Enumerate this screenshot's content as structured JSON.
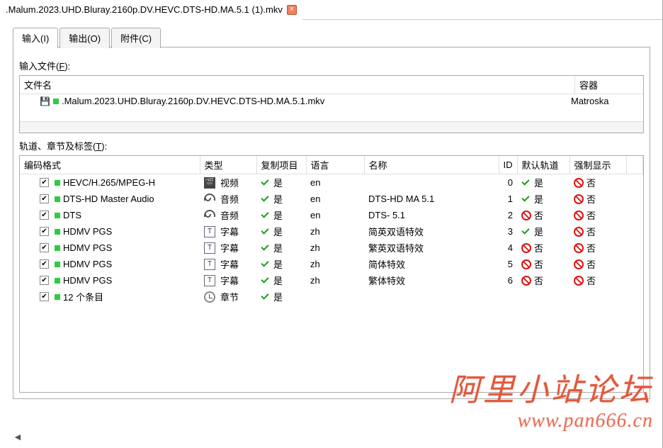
{
  "topTab": {
    "filename": ".Malum.2023.UHD.Bluray.2160p.DV.HEVC.DTS-HD.MA.5.1 (1).mkv"
  },
  "pageTabs": {
    "input": "输入(I)",
    "output": "输出(O)",
    "attach": "附件(C)"
  },
  "labels": {
    "inputFiles": "输入文件(F):",
    "tracksChapters": "轨道、章节及标签(T):"
  },
  "filesHeader": {
    "name": "文件名",
    "container": "容器"
  },
  "fileRow": {
    "name": ".Malum.2023.UHD.Bluray.2160p.DV.HEVC.DTS-HD.MA.5.1.mkv",
    "container": "Matroska"
  },
  "tracksHeader": {
    "codec": "编码格式",
    "type": "类型",
    "copy": "复制项目",
    "lang": "语言",
    "name": "名称",
    "id": "ID",
    "default": "默认轨道",
    "forced": "强制显示"
  },
  "typeLabels": {
    "video": "视频",
    "audio": "音频",
    "subtitle": "字幕",
    "chapter": "章节"
  },
  "yesNo": {
    "yes": "是",
    "no": "否"
  },
  "tracks": [
    {
      "codec": "HEVC/H.265/MPEG-H",
      "type": "video",
      "copy": true,
      "lang": "en",
      "name": "",
      "id": "0",
      "default": true,
      "forced": false
    },
    {
      "codec": "DTS-HD Master Audio",
      "type": "audio",
      "copy": true,
      "lang": "en",
      "name": "DTS-HD MA 5.1",
      "id": "1",
      "default": true,
      "forced": false
    },
    {
      "codec": "DTS",
      "type": "audio",
      "copy": true,
      "lang": "en",
      "name": "DTS- 5.1",
      "id": "2",
      "default": false,
      "forced": false
    },
    {
      "codec": "HDMV PGS",
      "type": "subtitle",
      "copy": true,
      "lang": "zh",
      "name": "简英双语特效",
      "id": "3",
      "default": true,
      "forced": false
    },
    {
      "codec": "HDMV PGS",
      "type": "subtitle",
      "copy": true,
      "lang": "zh",
      "name": "繁英双语特效",
      "id": "4",
      "default": false,
      "forced": false
    },
    {
      "codec": "HDMV PGS",
      "type": "subtitle",
      "copy": true,
      "lang": "zh",
      "name": "简体特效",
      "id": "5",
      "default": false,
      "forced": false
    },
    {
      "codec": "HDMV PGS",
      "type": "subtitle",
      "copy": true,
      "lang": "zh",
      "name": "繁体特效",
      "id": "6",
      "default": false,
      "forced": false
    },
    {
      "codec": "12 个条目",
      "type": "chapter",
      "copy": true,
      "lang": "",
      "name": "",
      "id": "",
      "default": null,
      "forced": null
    }
  ],
  "watermark": {
    "line1": "阿里小站论坛",
    "line2": "www.pan666.cn"
  }
}
